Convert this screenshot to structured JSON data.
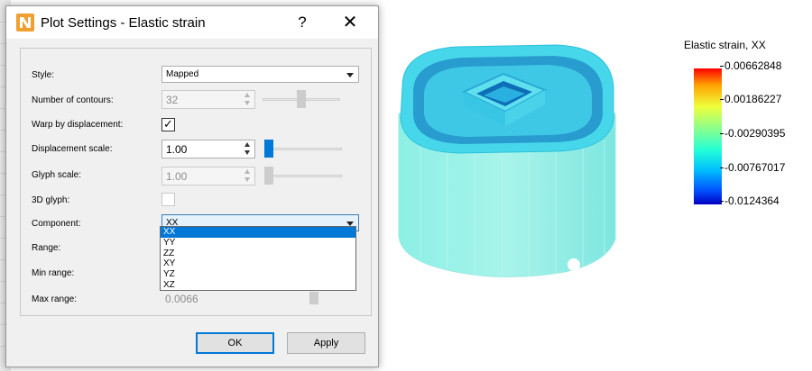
{
  "dialog": {
    "title": "Plot Settings - Elastic strain",
    "help_label": "?",
    "close_label": "✕"
  },
  "form": {
    "style": {
      "label": "Style:",
      "value": "Mapped"
    },
    "contours": {
      "label": "Number of contours:",
      "value": "32",
      "slider_fraction": 0.5
    },
    "warp": {
      "label": "Warp by displacement:",
      "checked": true,
      "check_glyph": "✓"
    },
    "disp_scale": {
      "label": "Displacement scale:",
      "value": "1.00",
      "slider_fraction": 0.0
    },
    "glyph_scale": {
      "label": "Glyph scale:",
      "value": "1.00",
      "slider_fraction": 0.0
    },
    "glyph3d": {
      "label": "3D glyph:",
      "checked": false
    },
    "component": {
      "label": "Component:",
      "value": "XX"
    },
    "range": {
      "label": "Range:"
    },
    "min_range": {
      "label": "Min range:"
    },
    "max_range": {
      "label": "Max range:",
      "value": "0.0066"
    }
  },
  "component_options": [
    "XX",
    "YY",
    "ZZ",
    "XY",
    "YZ",
    "XZ"
  ],
  "buttons": {
    "ok": "OK",
    "apply": "Apply"
  },
  "legend": {
    "title": "Elastic strain, XX",
    "ticks": [
      "0.00662848",
      "0.00186227",
      "-0.00290395",
      "-0.00767017",
      "-0.0124364"
    ]
  },
  "colors": {
    "accent": "#0078d7",
    "dialog_bg": "#f0f0f0"
  },
  "icons": {
    "app": "n-app-icon",
    "help": "question-icon",
    "close": "close-icon",
    "dropdown": "chevron-down-icon"
  }
}
